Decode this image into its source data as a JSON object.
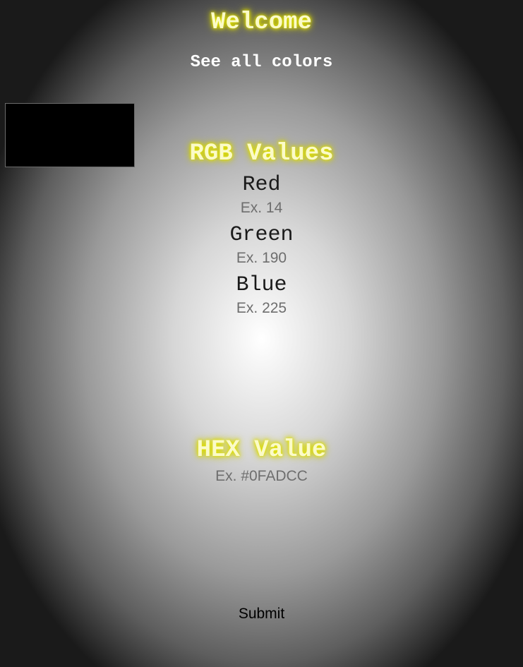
{
  "header": {
    "title": "Welcome",
    "see_all_link": "See all colors"
  },
  "preview": {
    "color": "#000000"
  },
  "rgb": {
    "title": "RGB Values",
    "red": {
      "label": "Red",
      "placeholder": "Ex. 14",
      "value": ""
    },
    "green": {
      "label": "Green",
      "placeholder": "Ex. 190",
      "value": ""
    },
    "blue": {
      "label": "Blue",
      "placeholder": "Ex. 225",
      "value": ""
    }
  },
  "hex": {
    "title": "HEX Value",
    "placeholder": "Ex. #0FADCC",
    "value": ""
  },
  "actions": {
    "submit_label": "Submit"
  },
  "theme": {
    "title_glow": "#e6e600",
    "title_text": "#fbfbc8"
  }
}
